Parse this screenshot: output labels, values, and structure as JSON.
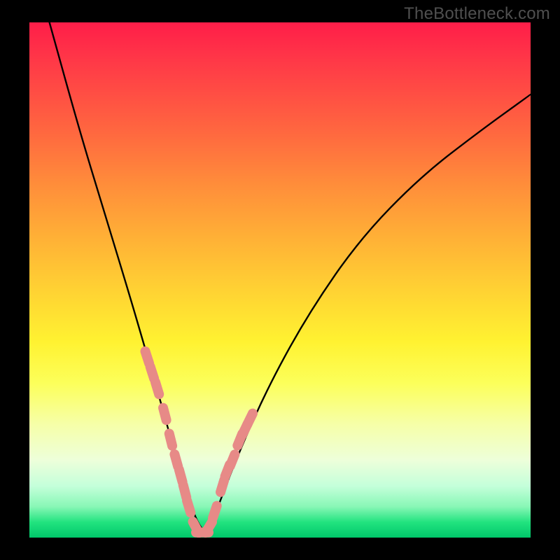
{
  "watermark": "TheBottleneck.com",
  "chart_data": {
    "type": "line",
    "title": "",
    "xlabel": "",
    "ylabel": "",
    "xlim": [
      0,
      100
    ],
    "ylim": [
      0,
      100
    ],
    "grid": false,
    "legend": false,
    "series": [
      {
        "name": "curve",
        "type": "line",
        "color": "#000000",
        "x": [
          4,
          10,
          15,
          20,
          23,
          26,
          28,
          30,
          32,
          33.5,
          35,
          36.5,
          38,
          42,
          48,
          56,
          66,
          78,
          90,
          100
        ],
        "y": [
          100,
          79,
          63,
          47,
          37,
          27,
          20,
          13,
          7,
          3,
          1,
          3,
          7,
          17,
          30,
          44,
          58,
          70,
          79,
          86
        ]
      },
      {
        "name": "marker-band",
        "type": "scatter",
        "color": "#e78a87",
        "x": [
          23.5,
          24.5,
          25.5,
          27.0,
          28.2,
          29.3,
          30.2,
          31.0,
          31.8,
          33.2,
          34.5,
          35.8,
          37.0,
          38.5,
          39.5,
          40.5,
          42.0,
          43.0,
          44.0
        ],
        "y": [
          35,
          32,
          29,
          24,
          19,
          15,
          12,
          9,
          6,
          2,
          1,
          2,
          5,
          10,
          13,
          15,
          19,
          21,
          23
        ]
      }
    ]
  }
}
